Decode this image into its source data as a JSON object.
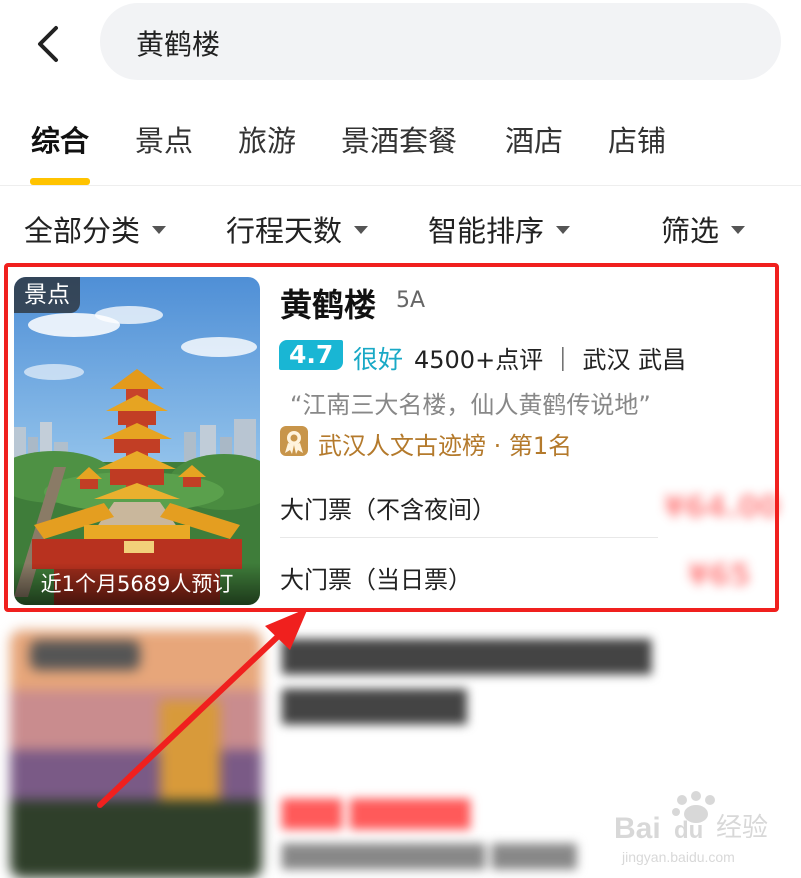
{
  "search": {
    "query": "黄鹤楼"
  },
  "tabs": [
    "综合",
    "景点",
    "旅游",
    "景酒套餐",
    "酒店",
    "店铺"
  ],
  "filters": [
    "全部分类",
    "行程天数",
    "智能排序",
    "筛选"
  ],
  "card": {
    "tag": "景点",
    "caption": "近1个月5689人预订",
    "title": "黄鹤楼",
    "level": "5A",
    "score": "4.7",
    "rating_word": "很好",
    "reviews": "4500+点评 ｜ 武汉 武昌",
    "quote": "“江南三大名楼，仙人黄鹤传说地”",
    "rank": "武汉人文古迹榜 · 第1名",
    "tickets": [
      {
        "name": "大门票（不含夜间）"
      },
      {
        "name": "大门票（当日票）"
      }
    ]
  },
  "watermark": {
    "brand": "Bai du 经验",
    "url": "jingyan.baidu.com"
  },
  "colors": {
    "accent": "#ffc300",
    "highlight": "#f0201e",
    "score_bg": "#19b6d4",
    "rank": "#b47a2c"
  },
  "icons": {
    "back": "chevron-left-icon",
    "filter": "caret-down-icon",
    "rank": "trophy-badge-icon"
  }
}
